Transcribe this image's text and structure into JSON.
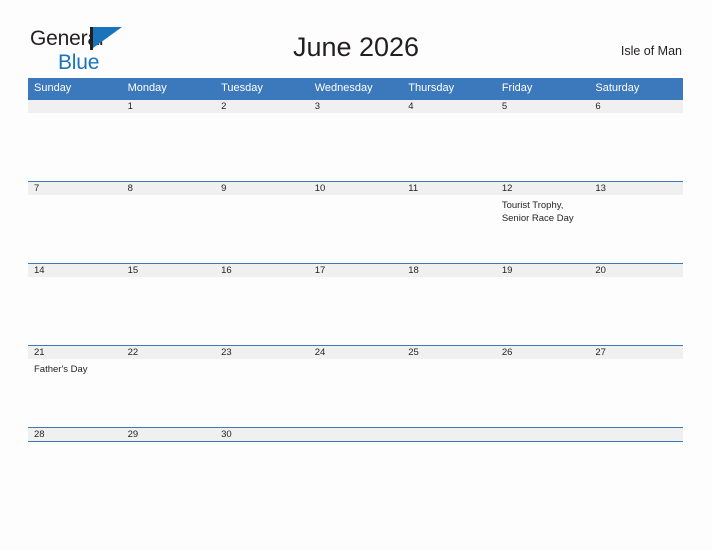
{
  "brand": {
    "word_one": "General",
    "word_two": "Blue",
    "flag_icon": "flag-icon",
    "accent_color": "#1a74bb"
  },
  "header": {
    "title": "June 2026",
    "location": "Isle of Man"
  },
  "theme": {
    "header_blue": "#3c78bc",
    "day_band_gray": "#f0f0f0",
    "cell_white": "#fdfdfd",
    "text_dark": "#231f20"
  },
  "calendar": {
    "weekdays": [
      "Sunday",
      "Monday",
      "Tuesday",
      "Wednesday",
      "Thursday",
      "Friday",
      "Saturday"
    ],
    "weeks": [
      [
        {
          "date": "",
          "events": []
        },
        {
          "date": "1",
          "events": []
        },
        {
          "date": "2",
          "events": []
        },
        {
          "date": "3",
          "events": []
        },
        {
          "date": "4",
          "events": []
        },
        {
          "date": "5",
          "events": []
        },
        {
          "date": "6",
          "events": []
        }
      ],
      [
        {
          "date": "7",
          "events": []
        },
        {
          "date": "8",
          "events": []
        },
        {
          "date": "9",
          "events": []
        },
        {
          "date": "10",
          "events": []
        },
        {
          "date": "11",
          "events": []
        },
        {
          "date": "12",
          "events": [
            "Tourist Trophy,",
            "Senior Race Day"
          ]
        },
        {
          "date": "13",
          "events": []
        }
      ],
      [
        {
          "date": "14",
          "events": []
        },
        {
          "date": "15",
          "events": []
        },
        {
          "date": "16",
          "events": []
        },
        {
          "date": "17",
          "events": []
        },
        {
          "date": "18",
          "events": []
        },
        {
          "date": "19",
          "events": []
        },
        {
          "date": "20",
          "events": []
        }
      ],
      [
        {
          "date": "21",
          "events": [
            "Father's Day"
          ]
        },
        {
          "date": "22",
          "events": []
        },
        {
          "date": "23",
          "events": []
        },
        {
          "date": "24",
          "events": []
        },
        {
          "date": "25",
          "events": []
        },
        {
          "date": "26",
          "events": []
        },
        {
          "date": "27",
          "events": []
        }
      ],
      [
        {
          "date": "28",
          "events": []
        },
        {
          "date": "29",
          "events": []
        },
        {
          "date": "30",
          "events": []
        },
        {
          "date": "",
          "events": []
        },
        {
          "date": "",
          "events": []
        },
        {
          "date": "",
          "events": []
        },
        {
          "date": "",
          "events": []
        }
      ]
    ]
  }
}
